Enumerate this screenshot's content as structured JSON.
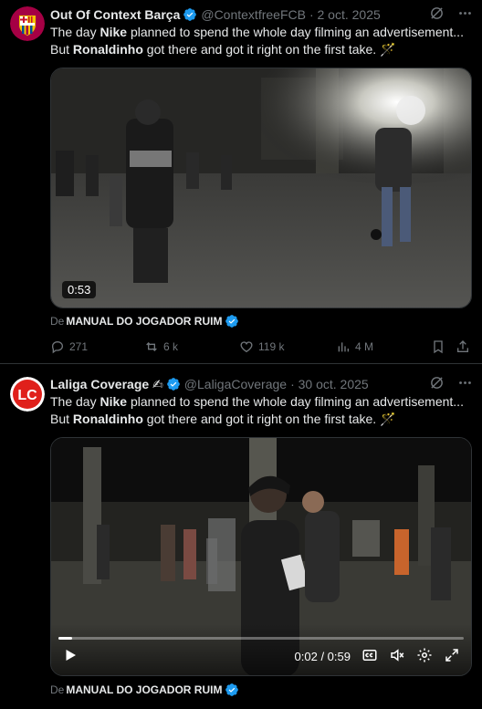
{
  "tweets": [
    {
      "name": "Out Of Context Barça",
      "handle": "@ContextfreeFCB",
      "date": "· 2 oct. 2025",
      "text_parts": [
        "The day ",
        "Nike",
        " planned to spend the whole day filming an advertisement... But ",
        "Ronaldinho",
        " got there and got it right on the first take. 🪄"
      ],
      "video_duration": "0:53",
      "from_prefix": "De",
      "from_source": "MANUAL DO JOGADOR RUIM",
      "stats": {
        "replies": "271",
        "reposts": "6 k",
        "likes": "119 k",
        "views": "4 M"
      }
    },
    {
      "name": "Laliga Coverage ✍",
      "handle": "@LaligaCoverage",
      "date": "· 30 oct. 2025",
      "text_parts": [
        "The day ",
        "Nike",
        " planned to spend the whole day filming an advertisement... But ",
        "Ronaldinho",
        " got there and got it right on the first take. 🪄"
      ],
      "video_time": "0:02 / 0:59",
      "video_progress": 0.034,
      "from_prefix": "De",
      "from_source": "MANUAL DO JOGADOR RUIM"
    }
  ],
  "icons": {
    "avatar1": "fc-barcelona-crest",
    "avatar2": "lc-logo",
    "verified": "verified-badge",
    "grok": "grok-icon",
    "more": "more-icon",
    "reply": "reply-icon",
    "repost": "repost-icon",
    "like": "heart-icon",
    "views": "views-icon",
    "bookmark": "bookmark-icon",
    "share": "share-icon",
    "play": "play-icon",
    "captions": "captions-icon",
    "mute": "mute-icon",
    "settings": "settings-icon",
    "fullscreen": "fullscreen-icon"
  },
  "colors": {
    "background": "#000000",
    "text": "#e7e9ea",
    "muted": "#71767b",
    "verified": "#1d9bf0",
    "lc_red": "#e0201b"
  }
}
